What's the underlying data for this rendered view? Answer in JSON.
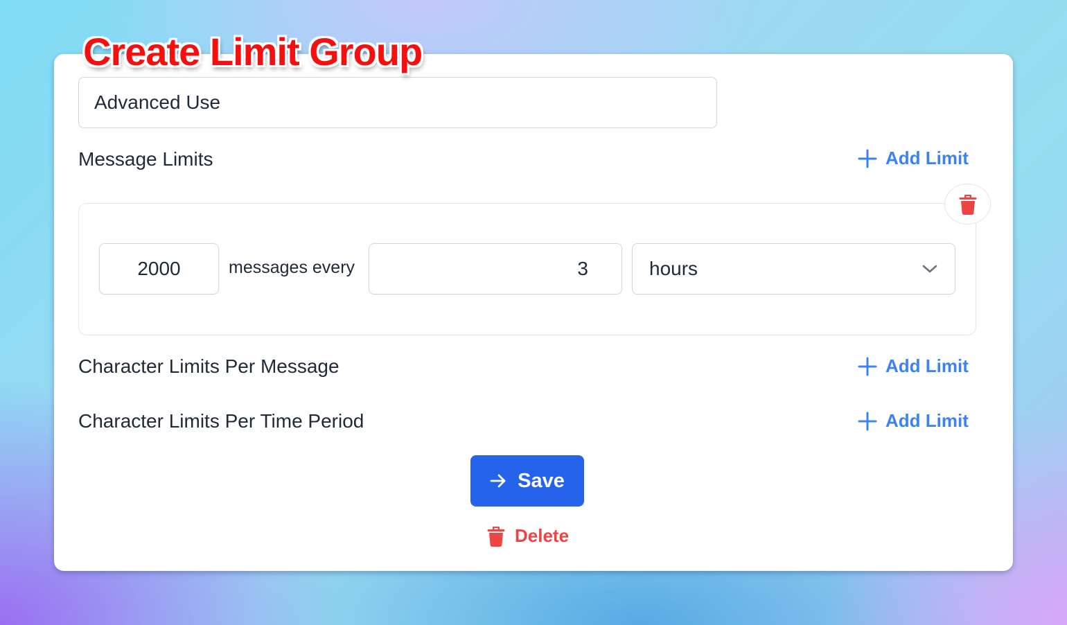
{
  "page": {
    "title": "Create Limit Group"
  },
  "form": {
    "group_name_value": "Advanced Use",
    "sections": [
      {
        "label": "Message Limits",
        "add_label": "Add Limit"
      },
      {
        "label": "Character Limits Per Message",
        "add_label": "Add Limit"
      },
      {
        "label": "Character Limits Per Time Period",
        "add_label": "Add Limit"
      }
    ],
    "message_limit": {
      "count": "2000",
      "between_text": "messages every",
      "period": "3",
      "unit": "hours"
    },
    "save_label": "Save",
    "delete_label": "Delete"
  },
  "icons": {
    "add": "plus-icon",
    "remove_limit": "trash-icon",
    "unit_dropdown": "chevron-down-icon",
    "save": "arrow-right-icon",
    "delete": "trash-icon"
  },
  "colors": {
    "accent": "#3b82f6",
    "primary_button": "#2563eb",
    "danger": "#ef4444",
    "title": "#f50f0f",
    "text": "#1f2937"
  }
}
